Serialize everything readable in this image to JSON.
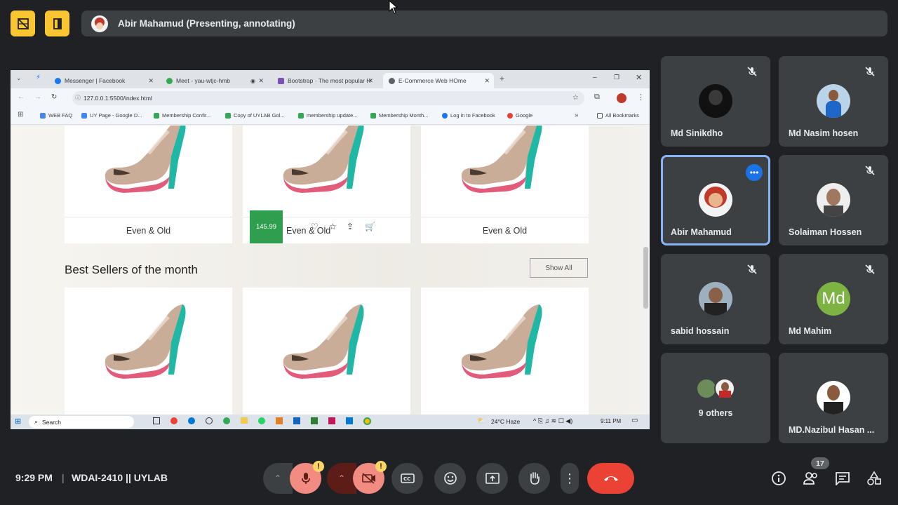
{
  "top_bar": {
    "presenter_label": "Abir Mahamud (Presenting, annotating)"
  },
  "browser": {
    "tabs": [
      {
        "label": "Messenger | Facebook"
      },
      {
        "label": "Meet - yau-wtjc-hmb"
      },
      {
        "label": "Bootstrap · The most popular H"
      },
      {
        "label": "E-Commerce Web HOme"
      }
    ],
    "url": "127.0.0.1:5500/index.html",
    "bookmarks": [
      {
        "label": "WEB FAQ"
      },
      {
        "label": "UY Page - Google D..."
      },
      {
        "label": "Membership Confir..."
      },
      {
        "label": "Copy of UYLAB Gol..."
      },
      {
        "label": "membership update..."
      },
      {
        "label": "Membership Month..."
      },
      {
        "label": "Log in to Facebook"
      },
      {
        "label": "Google"
      }
    ],
    "all_bookmarks": "All Bookmarks"
  },
  "website": {
    "top_row": [
      {
        "label": "Even & Old"
      },
      {
        "label": "Even & Old",
        "price": "145.99"
      },
      {
        "label": "Even & Old"
      }
    ],
    "section_title": "Best Sellers of the month",
    "show_all": "Show All"
  },
  "windows_taskbar": {
    "search": "Search",
    "weather": "24°C  Haze",
    "time": "9:11 PM"
  },
  "participants": [
    {
      "name": "Md Sinikdho"
    },
    {
      "name": "Md Nasim hosen"
    },
    {
      "name": "Abir Mahamud"
    },
    {
      "name": "Solaiman Hossen"
    },
    {
      "name": "sabid hossain"
    },
    {
      "name": "Md Mahim",
      "initials": "Md"
    },
    {
      "name": "9 others"
    },
    {
      "name": "MD.Nazibul Hasan ..."
    }
  ],
  "meeting": {
    "time": "9:29 PM",
    "separator": "|",
    "code": "WDAI-2410 || UYLAB",
    "people_count": "17",
    "warning_badge": "!"
  },
  "colors": {
    "accent_yellow": "#f9c631",
    "end_call": "#ea4335",
    "highlight": "#8ab4f8",
    "price_green": "#2e9e4f",
    "mahim_avatar": "#7cb342"
  }
}
